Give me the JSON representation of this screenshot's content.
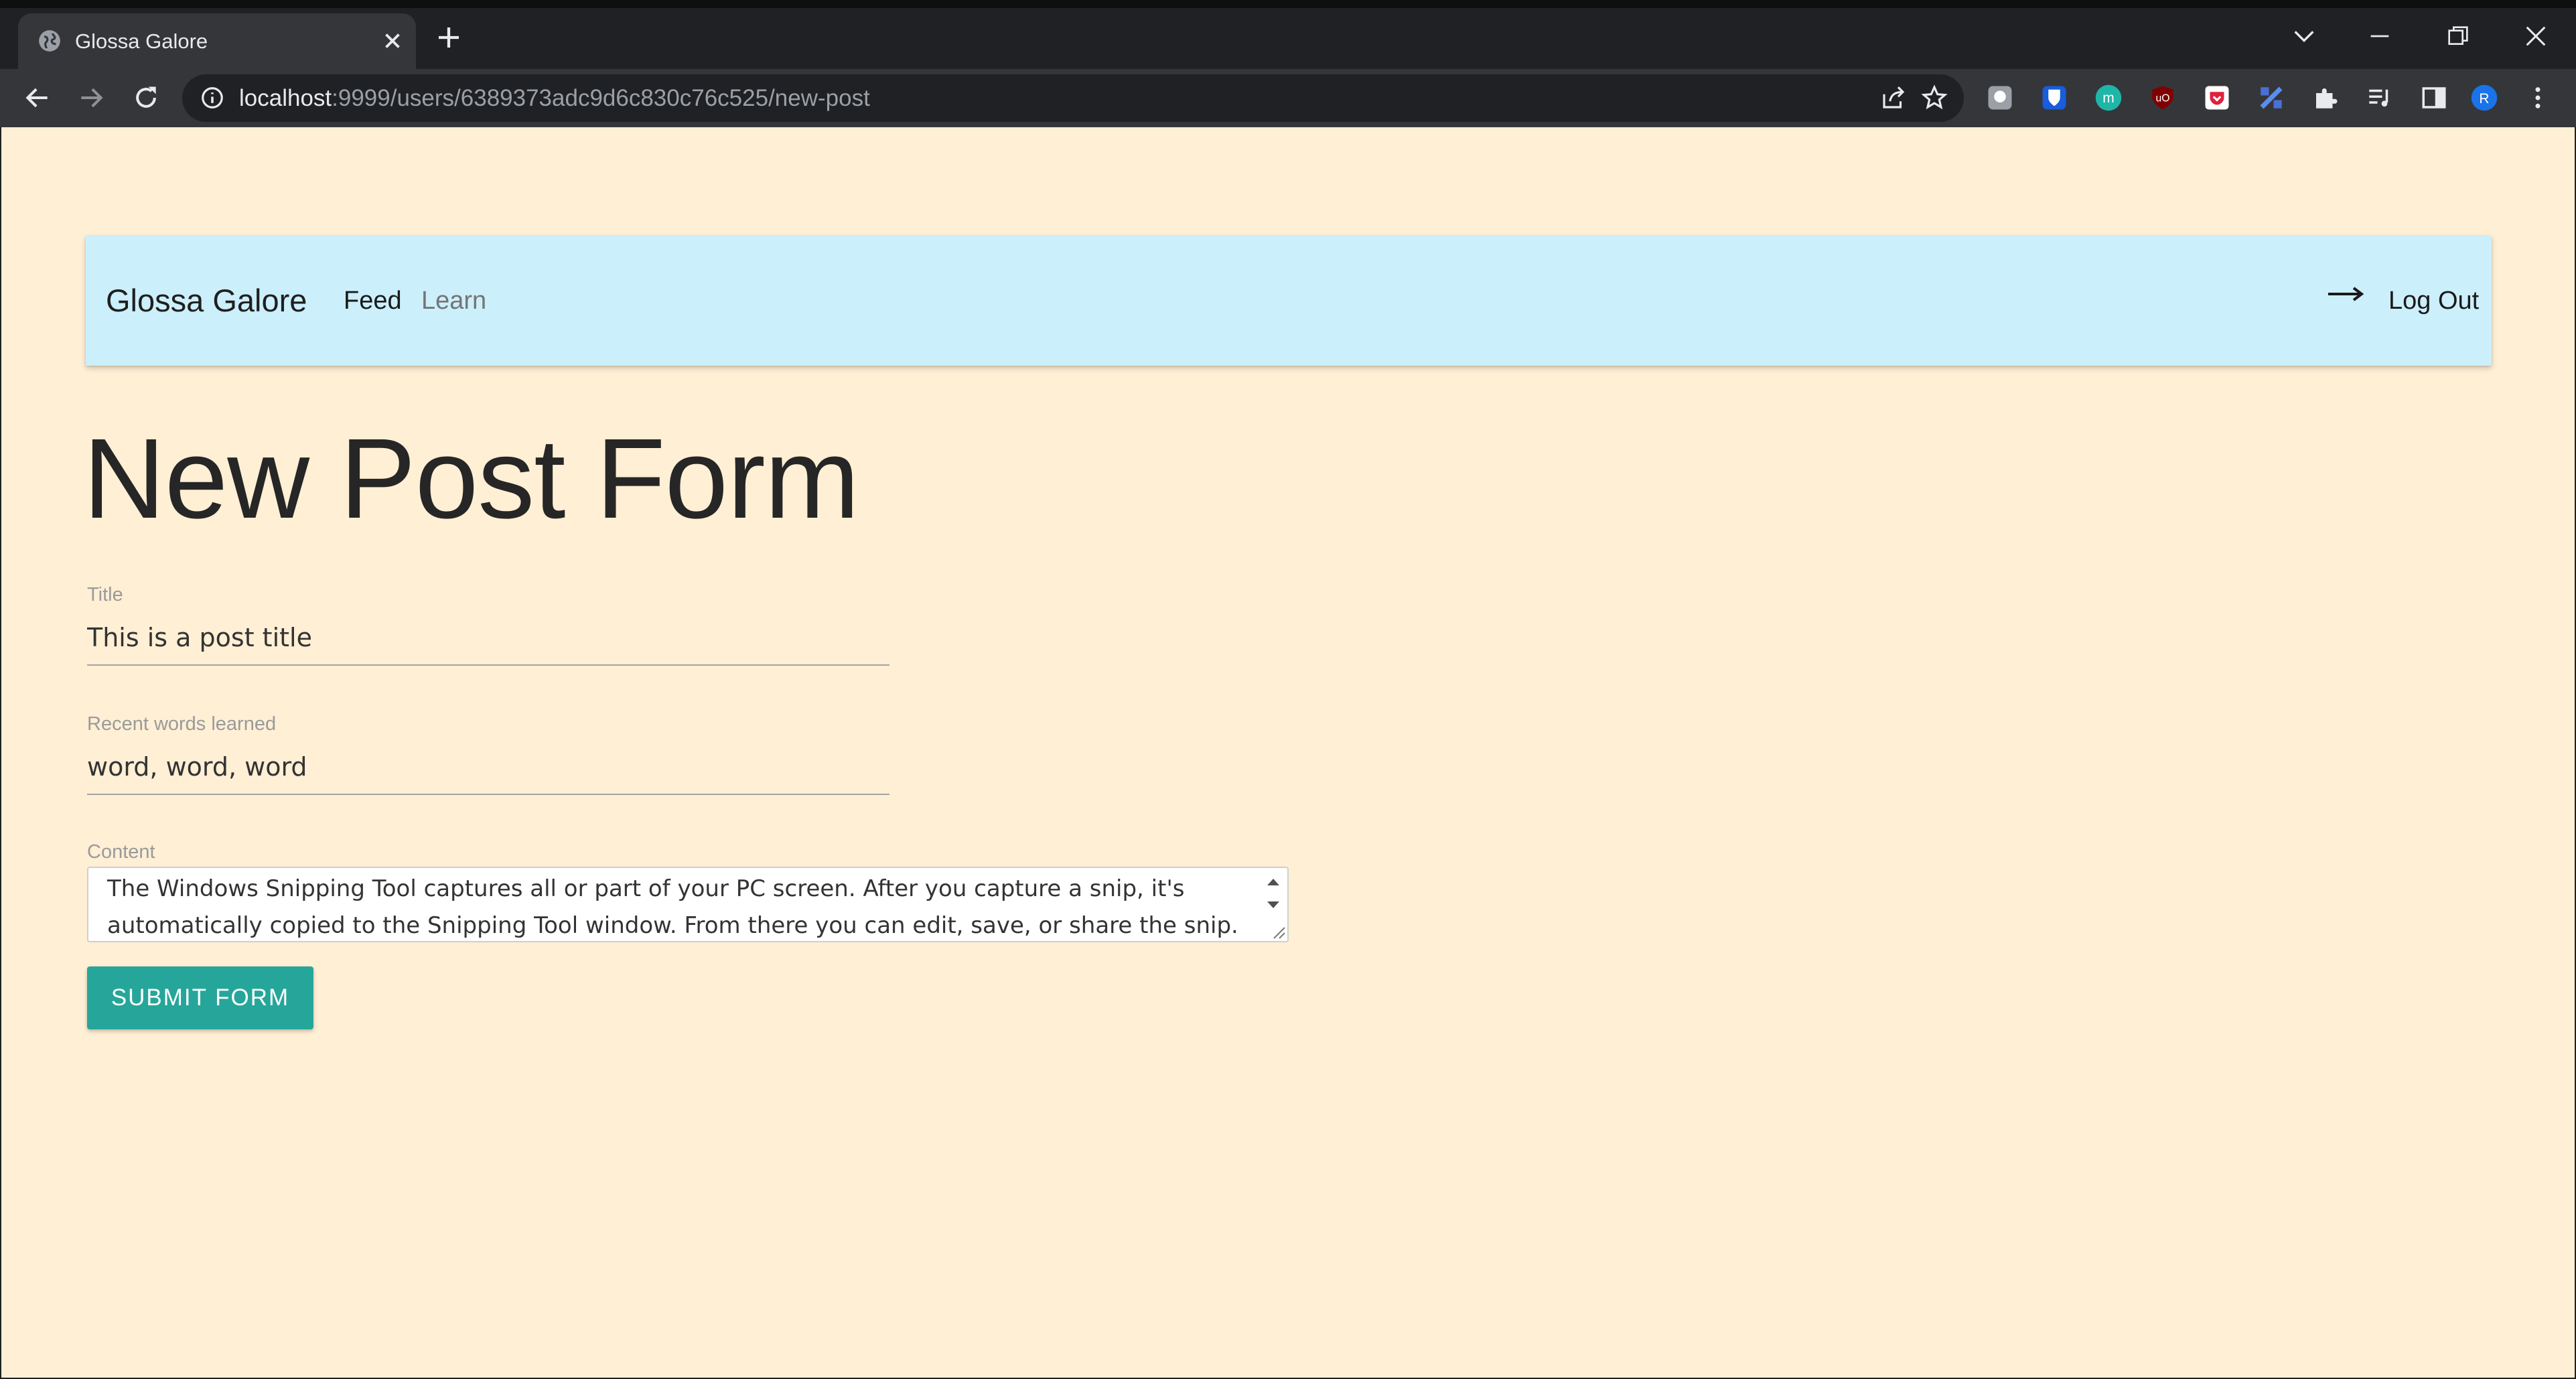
{
  "browser": {
    "tab_title": "Glossa Galore",
    "url_host": "localhost",
    "url_path": ":9999/users/6389373adc9d6c830c76c525/new-post",
    "profile_initial": "R"
  },
  "navbar": {
    "brand": "Glossa Galore",
    "links": [
      "Feed",
      "Learn"
    ],
    "logout_label": "Log Out"
  },
  "page": {
    "title": "New Post Form"
  },
  "form": {
    "title_label": "Title",
    "title_value": "This is a post title",
    "words_label": "Recent words learned",
    "words_value": "word, word, word",
    "content_label": "Content",
    "content_value": "The Windows Snipping Tool captures all or part of your PC screen. After you capture a snip, it's automatically copied to the Snipping Tool window. From there you can edit, save, or share the snip.",
    "submit_label": "SUBMIT FORM"
  },
  "colors": {
    "page_background": "#ffefd5",
    "navbar_background": "#cceffc",
    "submit_button": "#26a69a"
  },
  "icons": [
    "globe-icon",
    "close-icon",
    "plus-icon",
    "chevron-down-icon",
    "minimize-icon",
    "restore-icon",
    "back-icon",
    "forward-icon",
    "reload-icon",
    "info-icon",
    "share-icon",
    "star-icon",
    "puzzle-icon",
    "side-panel-icon",
    "menu-dots-icon",
    "arrow-right-icon"
  ]
}
